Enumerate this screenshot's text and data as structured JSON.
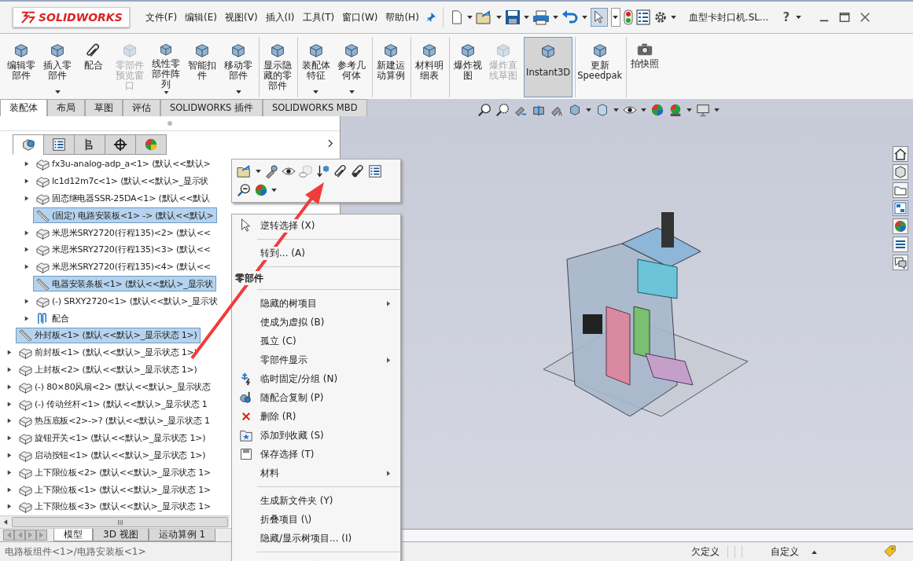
{
  "app": {
    "logo": "SOLIDWORKS",
    "menu": [
      "文件(F)",
      "编辑(E)",
      "视图(V)",
      "插入(I)",
      "工具(T)",
      "窗口(W)",
      "帮助(H)"
    ],
    "document_title": "血型卡封口机.SL...",
    "help": "?"
  },
  "ribbon": {
    "commands": [
      {
        "label": "编辑零部件",
        "disabled": false,
        "dropdown": false,
        "selected": false,
        "separator_before": false
      },
      {
        "label": "插入零部件",
        "disabled": false,
        "dropdown": true,
        "selected": false,
        "separator_before": false
      },
      {
        "label": "配合",
        "disabled": false,
        "dropdown": false,
        "selected": false,
        "separator_before": false
      },
      {
        "label": "零部件预览窗口",
        "disabled": true,
        "dropdown": false,
        "selected": false,
        "separator_before": false
      },
      {
        "label": "线性零部件阵列",
        "disabled": false,
        "dropdown": true,
        "selected": false,
        "separator_before": false
      },
      {
        "label": "智能扣件",
        "disabled": false,
        "dropdown": false,
        "selected": false,
        "separator_before": false
      },
      {
        "label": "移动零部件",
        "disabled": false,
        "dropdown": true,
        "selected": false,
        "separator_before": false
      },
      {
        "label": "显示隐藏的零部件",
        "disabled": false,
        "dropdown": false,
        "selected": false,
        "separator_before": true
      },
      {
        "label": "装配体特征",
        "disabled": false,
        "dropdown": true,
        "selected": false,
        "separator_before": true
      },
      {
        "label": "参考几何体",
        "disabled": false,
        "dropdown": true,
        "selected": false,
        "separator_before": false
      },
      {
        "label": "新建运动算例",
        "disabled": false,
        "dropdown": false,
        "selected": false,
        "separator_before": true
      },
      {
        "label": "材料明细表",
        "disabled": false,
        "dropdown": false,
        "selected": false,
        "separator_before": true
      },
      {
        "label": "爆炸视图",
        "disabled": false,
        "dropdown": false,
        "selected": false,
        "separator_before": true
      },
      {
        "label": "爆炸直线草图",
        "disabled": true,
        "dropdown": false,
        "selected": false,
        "separator_before": false
      },
      {
        "label": "Instant3D",
        "disabled": false,
        "dropdown": false,
        "selected": true,
        "separator_before": true
      },
      {
        "label": "更新 Speedpak",
        "disabled": false,
        "dropdown": false,
        "selected": false,
        "separator_before": true
      },
      {
        "label": "拍快照",
        "disabled": false,
        "dropdown": false,
        "selected": false,
        "separator_before": true
      }
    ],
    "tabs": [
      {
        "label": "装配体",
        "selected": true
      },
      {
        "label": "布局",
        "selected": false
      },
      {
        "label": "草图",
        "selected": false
      },
      {
        "label": "评估",
        "selected": false
      },
      {
        "label": "SOLIDWORKS 插件",
        "selected": false
      },
      {
        "label": "SOLIDWORKS MBD",
        "selected": false
      }
    ]
  },
  "feature_manager": {
    "panel_tabs": [
      {
        "selected": true
      },
      {
        "selected": false
      },
      {
        "selected": false
      },
      {
        "selected": false
      },
      {
        "selected": false
      }
    ],
    "tree": [
      {
        "expanded": true,
        "children": [
          {
            "kind": "part",
            "label": "fx3u-analog-adp_a<1> (默认<<默认>",
            "has_children": true,
            "selected": false
          },
          {
            "kind": "part",
            "label": "lc1d12m7c<1> (默认<<默认>_显示状",
            "has_children": true,
            "selected": false
          },
          {
            "kind": "part",
            "label": "固态继电器SSR-25DA<1> (默认<<默认",
            "has_children": true,
            "selected": false
          },
          {
            "kind": "plate",
            "label": "(固定) 电路安装板<1> -> (默认<<默认>",
            "has_children": false,
            "selected": true
          },
          {
            "kind": "part",
            "label": "米思米SRY2720(行程135)<2> (默认<<",
            "has_children": true,
            "selected": false
          },
          {
            "kind": "part",
            "label": "米思米SRY2720(行程135)<3> (默认<<",
            "has_children": true,
            "selected": false
          },
          {
            "kind": "part",
            "label": "米思米SRY2720(行程135)<4> (默认<<",
            "has_children": true,
            "selected": false
          },
          {
            "kind": "plate",
            "label": "电器安装条板<1> (默认<<默认>_显示状",
            "has_children": false,
            "selected": true
          },
          {
            "kind": "part",
            "label": "(-) SRXY2720<1> (默认<<默认>_显示状",
            "has_children": true,
            "selected": false
          },
          {
            "kind": "mates",
            "label": "配合",
            "has_children": true,
            "selected": false
          }
        ]
      },
      {
        "kind": "plate",
        "label": "外封板<1> (默认<<默认>_显示状态 1>)",
        "has_children": false,
        "selected": true
      },
      {
        "kind": "part",
        "label": "前封板<1> (默认<<默认>_显示状态 1>)",
        "has_children": true,
        "selected": false
      },
      {
        "kind": "part",
        "label": "上封板<2> (默认<<默认>_显示状态 1>)",
        "has_children": true,
        "selected": false
      },
      {
        "kind": "part",
        "label": "(-) 80×80风扇<2> (默认<<默认>_显示状态",
        "has_children": true,
        "selected": false
      },
      {
        "kind": "part",
        "label": "(-) 传动丝杆<1> (默认<<默认>_显示状态 1",
        "has_children": true,
        "selected": false
      },
      {
        "kind": "part",
        "label": "热压底板<2>->? (默认<<默认>_显示状态 1",
        "has_children": true,
        "selected": false
      },
      {
        "kind": "part",
        "label": "旋钮开关<1> (默认<<默认>_显示状态 1>)",
        "has_children": true,
        "selected": false
      },
      {
        "kind": "part",
        "label": "启动按钮<1> (默认<<默认>_显示状态 1>)",
        "has_children": true,
        "selected": false
      },
      {
        "kind": "part",
        "label": "上下限位板<2> (默认<<默认>_显示状态 1>",
        "has_children": true,
        "selected": false
      },
      {
        "kind": "part",
        "label": "上下限位板<1> (默认<<默认>_显示状态 1>",
        "has_children": true,
        "selected": false
      },
      {
        "kind": "part",
        "label": "上下限位板<3> (默认<<默认>_显示状态 1>",
        "has_children": true,
        "selected": false
      }
    ],
    "bottom_tabs": [
      {
        "label": "模型",
        "selected": true
      },
      {
        "label": "3D 视图",
        "selected": false
      },
      {
        "label": "运动算例 1",
        "selected": false
      }
    ]
  },
  "context_menu": {
    "items": [
      {
        "kind": "item",
        "label": "逆转选择 (X)",
        "submenu": false
      },
      {
        "kind": "separator"
      },
      {
        "kind": "item",
        "label": "转到... (A)",
        "submenu": false
      },
      {
        "kind": "separator"
      },
      {
        "kind": "header",
        "label": "零部件"
      },
      {
        "kind": "separator"
      },
      {
        "kind": "item",
        "label": "隐藏的树项目",
        "submenu": true
      },
      {
        "kind": "item",
        "label": "使成为虚拟 (B)",
        "submenu": false
      },
      {
        "kind": "item",
        "label": "孤立 (C)",
        "submenu": false
      },
      {
        "kind": "item",
        "label": "零部件显示",
        "submenu": true
      },
      {
        "kind": "item",
        "label": "临时固定/分组 (N)",
        "submenu": false
      },
      {
        "kind": "item",
        "label": "随配合复制 (P)",
        "submenu": false
      },
      {
        "kind": "item",
        "label": "删除 (R)",
        "submenu": false
      },
      {
        "kind": "item",
        "label": "添加到收藏 (S)",
        "submenu": false
      },
      {
        "kind": "item",
        "label": "保存选择 (T)",
        "submenu": false
      },
      {
        "kind": "item",
        "label": "材料",
        "submenu": true
      },
      {
        "kind": "separator"
      },
      {
        "kind": "item",
        "label": "生成新文件夹 (Y)",
        "submenu": false
      },
      {
        "kind": "item",
        "label": "折叠项目 (\\)",
        "submenu": false
      },
      {
        "kind": "item",
        "label": "隐藏/显示树项目... (I)",
        "submenu": false
      },
      {
        "kind": "separator"
      },
      {
        "kind": "more"
      }
    ]
  },
  "status_bar": {
    "path": "电路板组件<1>/电路安装板<1>",
    "definition": "欠定义",
    "units": "自定义"
  }
}
